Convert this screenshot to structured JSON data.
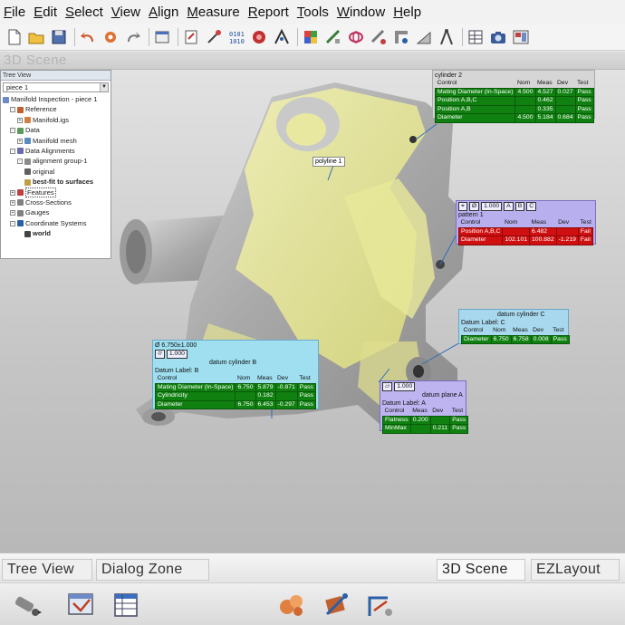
{
  "menu": [
    "File",
    "Edit",
    "Select",
    "View",
    "Align",
    "Measure",
    "Report",
    "Tools",
    "Window",
    "Help"
  ],
  "menu_mnemonics": [
    "F",
    "E",
    "S",
    "V",
    "A",
    "M",
    "R",
    "T",
    "W",
    "H"
  ],
  "toolbar_icons": [
    "new-icon",
    "open-icon",
    "save-icon",
    "undo-icon",
    "settings-icon",
    "redo-icon",
    "report-icon",
    "import-icon",
    "probe-icon",
    "binary-icon",
    "point-cloud-icon",
    "alignment-icon",
    "color-map-icon",
    "measure-icon",
    "surface-icon",
    "section-icon",
    "gauge-icon",
    "caliper-icon",
    "compass-icon",
    "table-icon",
    "camera-icon",
    "layout-icon"
  ],
  "scene": {
    "title": "3D Scene"
  },
  "tree": {
    "header": "Tree View",
    "selected_piece": "piece 1",
    "rows": [
      {
        "label": "Manifold Inspection - piece 1",
        "indent": 0,
        "exp": "",
        "bold": false
      },
      {
        "label": "Reference",
        "indent": 1,
        "exp": "-",
        "bold": false
      },
      {
        "label": "Manifold.igs",
        "indent": 2,
        "exp": "+",
        "bold": false
      },
      {
        "label": "Data",
        "indent": 1,
        "exp": "-",
        "bold": false
      },
      {
        "label": "Manifold mesh",
        "indent": 2,
        "exp": "+",
        "bold": false
      },
      {
        "label": "Data Alignments",
        "indent": 1,
        "exp": "-",
        "bold": false
      },
      {
        "label": "alignment group-1",
        "indent": 2,
        "exp": "-",
        "bold": false
      },
      {
        "label": "original",
        "indent": 3,
        "exp": "",
        "bold": false
      },
      {
        "label": "best-fit to surfaces",
        "indent": 3,
        "exp": "",
        "bold": true
      },
      {
        "label": "Features",
        "indent": 1,
        "exp": "+",
        "bold": false,
        "selected": true
      },
      {
        "label": "Cross-Sections",
        "indent": 1,
        "exp": "+",
        "bold": false
      },
      {
        "label": "Gauges",
        "indent": 1,
        "exp": "+",
        "bold": false
      },
      {
        "label": "Coordinate Systems",
        "indent": 1,
        "exp": "-",
        "bold": false
      },
      {
        "label": "world",
        "indent": 3,
        "exp": "",
        "bold": true
      }
    ]
  },
  "callouts": {
    "cyl2": {
      "title": "cylinder 2",
      "header": [
        "Control",
        "Nom",
        "Meas",
        "Dev",
        "Test"
      ],
      "rows": [
        [
          "Mating Diameter (In-Space)",
          "4.500",
          "4.527",
          "0.027",
          "Pass"
        ],
        [
          "Position A,B,C",
          "",
          "0.462",
          "",
          "Pass"
        ],
        [
          "Position A,B",
          "",
          "0.335",
          "",
          "Pass"
        ],
        [
          "Diameter",
          "4.500",
          "5.184",
          "0.684",
          "Pass"
        ]
      ]
    },
    "pattern": {
      "fcf": [
        "⌖",
        "Ø",
        "1.000",
        "A",
        "B",
        "C"
      ],
      "title": "pattern 1",
      "header": [
        "Control",
        "Nom",
        "Meas",
        "Dev",
        "Test"
      ],
      "rows": [
        [
          "Position A,B,C",
          "",
          "6.482",
          "",
          "Fail"
        ],
        [
          "Diameter",
          "102.101",
          "100.882",
          "-1.219",
          "Fail"
        ]
      ]
    },
    "datumC": {
      "title": "datum cylinder C",
      "datum_label": "Datum Label:  C",
      "header": [
        "Control",
        "Nom",
        "Meas",
        "Dev",
        "Test"
      ],
      "rows": [
        [
          "Diameter",
          "6.750",
          "6.758",
          "0.008",
          "Pass"
        ]
      ]
    },
    "datumB": {
      "dim_line": "Ø  6.750±1.000",
      "fcf": [
        "⌭",
        "1.000"
      ],
      "title": "datum cylinder B",
      "datum_label": "Datum Label:  B",
      "header": [
        "Control",
        "Nom",
        "Meas",
        "Dev",
        "Test"
      ],
      "rows": [
        [
          "Mating Diameter (In-Space)",
          "6.750",
          "5.879",
          "-0.871",
          "Pass"
        ],
        [
          "Cylindricity",
          "",
          "0.182",
          "",
          "Pass"
        ],
        [
          "Diameter",
          "6.750",
          "6.453",
          "-0.297",
          "Pass"
        ]
      ]
    },
    "datumA": {
      "fcf": [
        "⏥",
        "1.000"
      ],
      "title": "datum plane A",
      "datum_label": "Datum Label:  A",
      "header": [
        "Control",
        "Meas",
        "Dev",
        "Test"
      ],
      "rows": [
        [
          "Flatness",
          "0.200",
          "",
          "Pass"
        ],
        [
          "MinMax",
          "",
          "0.211",
          "Pass"
        ]
      ]
    },
    "polyline": {
      "title": "polyline 1"
    }
  },
  "bottom_tabs": [
    {
      "label": "Tree View",
      "active": false
    },
    {
      "label": "Dialog Zone",
      "active": false
    },
    {
      "label": "3D Scene",
      "active": true
    },
    {
      "label": "EZLayout",
      "active": false
    }
  ],
  "bottom_tool_icons": [
    "probe-tool-icon",
    "dialog-tool-icon",
    "table-tool-icon",
    "feature-tool-icon",
    "alignment-tool-icon",
    "measure-tool-icon"
  ],
  "colors": {
    "pass": "#108010",
    "fail": "#d01010",
    "mesh": "#e4e48a",
    "part": "#b8b8b8"
  }
}
